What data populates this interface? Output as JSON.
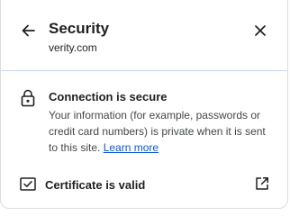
{
  "header": {
    "title": "Security",
    "subtitle": "verity.com",
    "back_icon": "arrow-back-icon",
    "close_icon": "close-icon"
  },
  "connection": {
    "title": "Connection is secure",
    "description": "Your information (for example, passwords or credit card numbers) is private when it is sent to this site.",
    "learn_more_label": "Learn more",
    "icon": "lock-icon"
  },
  "certificate": {
    "label": "Certificate is valid",
    "icon": "certificate-icon",
    "open_icon": "open-in-new-icon"
  },
  "colors": {
    "link": "#0b57d0",
    "text": "#1f1f1f",
    "secondary_text": "#444746",
    "divider": "#c7d8ea"
  }
}
